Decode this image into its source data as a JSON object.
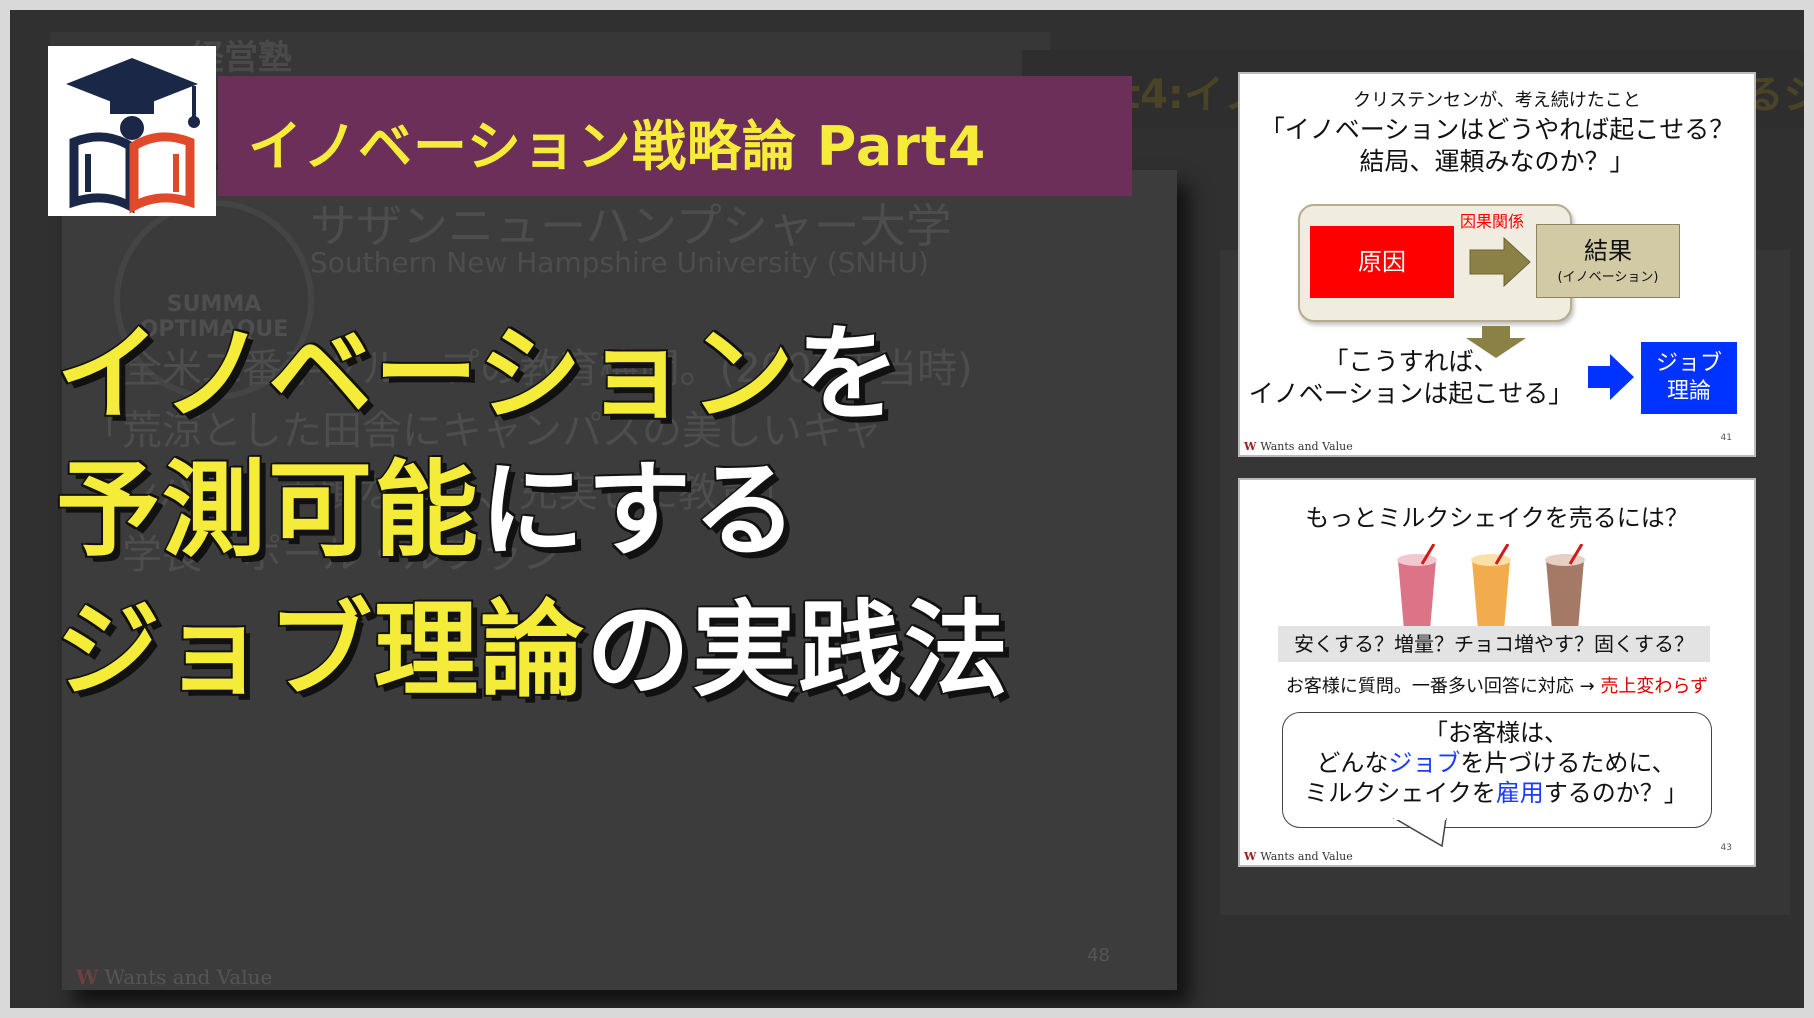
{
  "background": {
    "top_label": "経営塾",
    "right_title": "Part4:イノベーションを予測可能にするジョブ理論",
    "seal_text": "SUMMA OPTIMAQUE",
    "lines": [
      {
        "text": "サザンニューハンプシャー大学",
        "size": 46
      },
      {
        "text": "Southern New Hampshire University (SNHU)",
        "size": 28
      },
      {
        "text": "・全米二番手グループの教育機関。(2003年当時)",
        "size": 40
      },
      {
        "text": "「荒涼とした田舎にキャンパスの美しいキャ",
        "size": 40
      },
      {
        "text": "ンパス、手頃な学費、充実した教育」",
        "size": 40
      },
      {
        "text": "・学長　ポール・ルブラン",
        "size": 40
      }
    ],
    "page_number": "48",
    "logo_text": "Wants and Value"
  },
  "banner": {
    "title": "イノベーション戦略論 Part4"
  },
  "headline": {
    "line1_yellow": "イノベーション",
    "line1_white": "を",
    "line2_yellow": "予測可能",
    "line2_white": "にする",
    "line3_yellow": "ジョブ理論",
    "line3_white": "の実践法"
  },
  "slide1": {
    "title_small": "クリステンセンが、考え続けたこと",
    "title_line1": "「イノベーションはどうやれば起こせる？",
    "title_line2": "結局、運頼みなのか？」",
    "cause": "原因",
    "causal_label": "因果関係",
    "result_title": "結果",
    "result_sub": "(イノベーション)",
    "quote_line1": "「こうすれば、",
    "quote_line2": "イノベーションは起こせる」",
    "job_line1": "ジョブ",
    "job_line2": "理論",
    "footer": "Wants and Value",
    "page_number": "41"
  },
  "slide2": {
    "title": "もっとミルクシェイクを売るには？",
    "options": "安くする？増量？チョコ増やす？固くする？",
    "survey": "お客様に質問。一番多い回答に対応 → ",
    "survey_result": "売上変わらず",
    "bubble_line1": "「お客様は、",
    "bubble_line2_a": "どんな",
    "bubble_line2_b": "ジョブ",
    "bubble_line2_c": "を片づけるために、",
    "bubble_line3_a": "ミルクシェイクを",
    "bubble_line3_b": "雇用",
    "bubble_line3_c": "するのか？」",
    "footer": "Wants and Value",
    "page_number": "43"
  },
  "colors": {
    "banner_bg": "#6b2f5a",
    "headline_yellow": "#f5ec3a",
    "job_blue": "#0033ff",
    "cause_red": "#ff0000"
  }
}
